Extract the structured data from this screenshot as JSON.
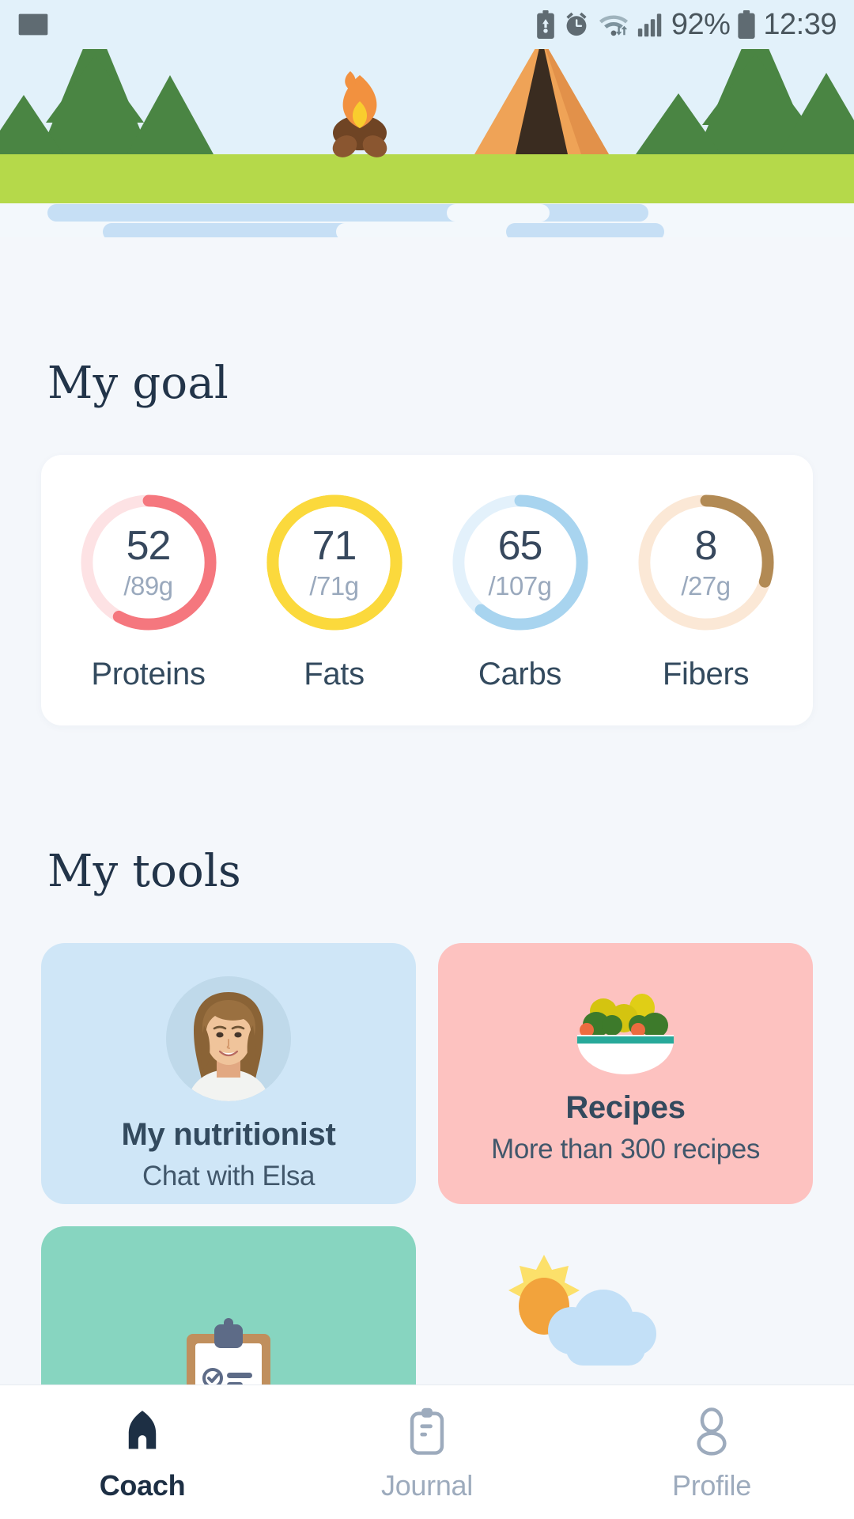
{
  "status_bar": {
    "mail_icon": "mail-icon",
    "battery_saver_icon": "battery-saver-icon",
    "alarm_icon": "alarm-icon",
    "wifi_icon": "wifi-icon",
    "signal_icon": "cellular-signal-icon",
    "battery_percent": "92%",
    "battery_icon": "battery-icon",
    "time": "12:39"
  },
  "hero": {
    "name": "camping-scene-illustration",
    "colors": {
      "sky": "#e2f1fa",
      "grass": "#b5d94a",
      "water": "#f3f8fc",
      "water_wave": "#c6dff5",
      "tree": "#4a8543",
      "tent": "#efa357",
      "tent_dark": "#3a2c20",
      "fire_outer": "#f2913f",
      "fire_inner": "#f9cd2e",
      "log": "#6f4424"
    }
  },
  "goal": {
    "title": "My goal",
    "macros": [
      {
        "label": "Proteins",
        "value": "52",
        "total": "/89g",
        "current": 52,
        "target": 89,
        "percent": 58,
        "color": "#f5777e",
        "track": "#fde2e4"
      },
      {
        "label": "Fats",
        "value": "71",
        "total": "/71g",
        "current": 71,
        "target": 71,
        "percent": 100,
        "color": "#fbd93c",
        "track": "#fbd93c"
      },
      {
        "label": "Carbs",
        "value": "65",
        "total": "/107g",
        "current": 65,
        "target": 107,
        "percent": 61,
        "color": "#a8d4ef",
        "track": "#e3f1fb"
      },
      {
        "label": "Fibers",
        "value": "8",
        "total": "/27g",
        "current": 8,
        "target": 27,
        "percent": 30,
        "color": "#b28a54",
        "track": "#fbe8d6"
      }
    ]
  },
  "tools": {
    "title": "My tools",
    "cards": [
      {
        "title": "My nutritionist",
        "subtitle": "Chat with Elsa",
        "icon": "nutritionist-avatar",
        "bg": "#cfe6f7"
      },
      {
        "title": "Recipes",
        "subtitle": "More than 300 recipes",
        "icon": "salad-bowl-icon",
        "bg": "#fdc2c0"
      }
    ],
    "cards_partial": [
      {
        "icon": "clipboard-checklist-icon",
        "bg": "#87d5c0"
      },
      {
        "icon": "sun-cloud-icon",
        "bg": "transparent"
      }
    ]
  },
  "bottom_nav": {
    "items": [
      {
        "label": "Coach",
        "icon": "home-icon",
        "active": true
      },
      {
        "label": "Journal",
        "icon": "clipboard-icon",
        "active": false
      },
      {
        "label": "Profile",
        "icon": "person-icon",
        "active": false
      }
    ]
  }
}
